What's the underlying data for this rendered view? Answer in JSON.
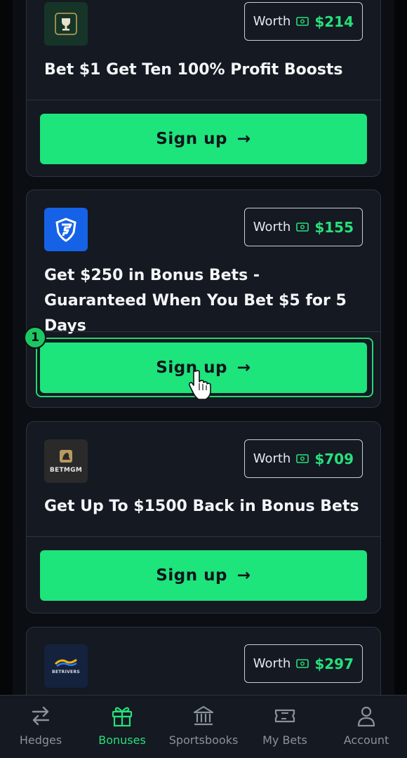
{
  "offers": [
    {
      "logo": "trophy-logo",
      "worth_label": "Worth",
      "worth_value": "$214",
      "title": "Bet $1 Get Ten 100% Profit Boosts",
      "signup_label": "Sign up",
      "arrow": "→"
    },
    {
      "logo": "fanduel-logo",
      "worth_label": "Worth",
      "worth_value": "$155",
      "title": "Get $250 in Bonus Bets - Guaranteed When You Bet $5 for 5 Days",
      "signup_label": "Sign up",
      "arrow": "→"
    },
    {
      "logo": "betmgm-logo",
      "logo_text": "BETMGM",
      "worth_label": "Worth",
      "worth_value": "$709",
      "title": "Get Up To $1500 Back in Bonus Bets",
      "signup_label": "Sign up",
      "arrow": "→"
    },
    {
      "logo": "betrivers-logo",
      "logo_text": "BETRIVERS",
      "worth_label": "Worth",
      "worth_value": "$297"
    }
  ],
  "highlight_badge": "1",
  "tabs": [
    {
      "label": "Hedges",
      "icon": "swap-arrows-icon",
      "active": false
    },
    {
      "label": "Bonuses",
      "icon": "gift-icon",
      "active": true
    },
    {
      "label": "Sportsbooks",
      "icon": "bank-icon",
      "active": false
    },
    {
      "label": "My Bets",
      "icon": "ticket-icon",
      "active": false
    },
    {
      "label": "Account",
      "icon": "user-icon",
      "active": false
    }
  ],
  "colors": {
    "background": "#0b0e13",
    "card": "#141922",
    "accent_green": "#1de47b",
    "worth_green": "#27e07a"
  }
}
